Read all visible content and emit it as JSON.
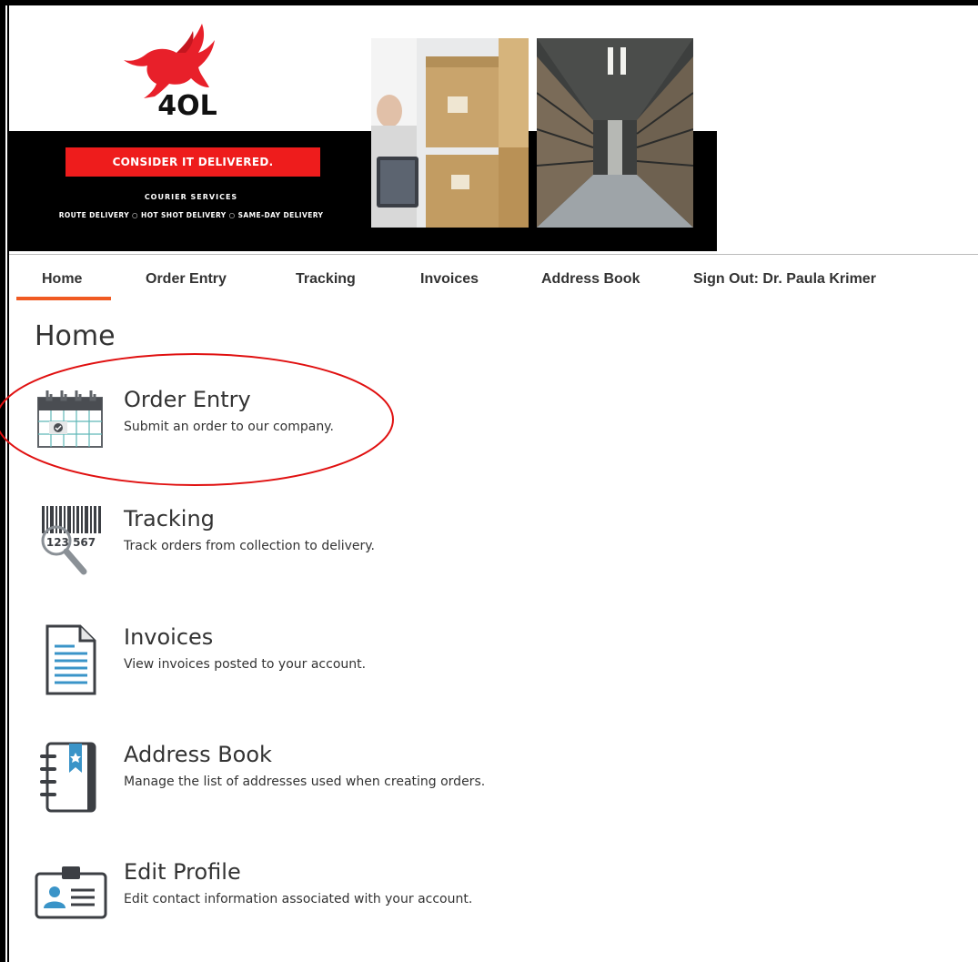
{
  "banner": {
    "logo_text": "4OL",
    "slogan": "CONSIDER IT DELIVERED.",
    "services_title": "COURIER SERVICES",
    "services": [
      "ROUTE DELIVERY",
      "HOT SHOT DELIVERY",
      "SAME-DAY DELIVERY"
    ],
    "separator": "○",
    "accent_red": "#ee1c1c"
  },
  "nav": {
    "items": [
      {
        "label": "Home",
        "active": true
      },
      {
        "label": "Order Entry"
      },
      {
        "label": "Tracking"
      },
      {
        "label": "Invoices"
      },
      {
        "label": "Address Book"
      },
      {
        "label": "Sign Out: Dr. Paula Krimer"
      }
    ],
    "active_color": "#f05a22"
  },
  "page": {
    "title": "Home",
    "menu": [
      {
        "title": "Order Entry",
        "desc": "Submit an order to our company.",
        "icon": "calendar-icon"
      },
      {
        "title": "Tracking",
        "desc": "Track orders from collection to delivery.",
        "icon": "barcode-search-icon",
        "icon_text": "123 567"
      },
      {
        "title": "Invoices",
        "desc": "View invoices posted to your account.",
        "icon": "document-icon"
      },
      {
        "title": "Address Book",
        "desc": "Manage the list of addresses used when creating orders.",
        "icon": "address-book-icon"
      },
      {
        "title": "Edit Profile",
        "desc": "Edit contact information associated with your account.",
        "icon": "id-card-icon"
      }
    ]
  },
  "annotation": {
    "shape": "ellipse",
    "color": "#e01010",
    "target": "Order Entry"
  }
}
